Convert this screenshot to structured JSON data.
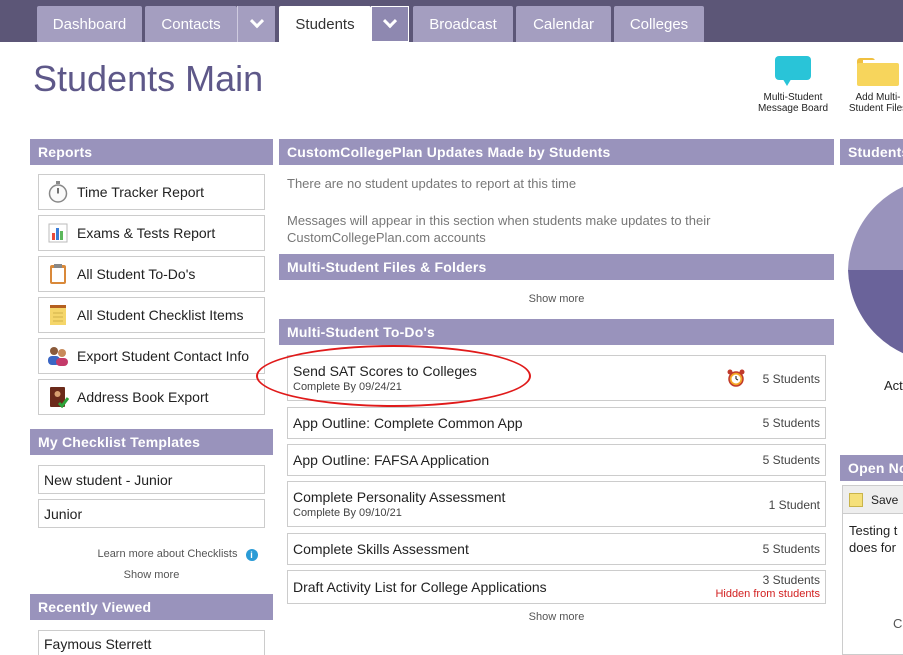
{
  "nav": {
    "tabs": [
      {
        "label": "Dashboard"
      },
      {
        "label": "Contacts"
      },
      {
        "label": "Students"
      },
      {
        "label": "Broadcast"
      },
      {
        "label": "Calendar"
      },
      {
        "label": "Colleges"
      }
    ]
  },
  "page": {
    "title": "Students Main"
  },
  "top_icons": [
    {
      "label": "Multi-Student Message Board",
      "icon": "speech-bubble-icon",
      "color": "#29c4d8"
    },
    {
      "label": "Add Multi-Student Files",
      "icon": "folder-icon",
      "color": "#f7d55c"
    }
  ],
  "reports": {
    "title": "Reports",
    "items": [
      {
        "label": "Time Tracker Report",
        "icon": "stopwatch-icon"
      },
      {
        "label": "Exams & Tests Report",
        "icon": "bar-chart-icon"
      },
      {
        "label": "All Student To-Do's",
        "icon": "clipboard-icon"
      },
      {
        "label": "All Student Checklist Items",
        "icon": "notepad-icon"
      },
      {
        "label": "Export Student Contact Info",
        "icon": "people-icon"
      },
      {
        "label": "Address Book Export",
        "icon": "address-book-icon"
      }
    ]
  },
  "checklists": {
    "title": "My Checklist Templates",
    "items": [
      {
        "label": "New student - Junior"
      },
      {
        "label": "Junior"
      }
    ],
    "learn_more": "Learn more about Checklists",
    "show_more": "Show more"
  },
  "recent": {
    "title": "Recently Viewed",
    "items": [
      {
        "label": "Faymous Sterrett"
      }
    ]
  },
  "updates": {
    "title": "CustomCollegePlan Updates Made by Students",
    "empty": "There are no student updates to report at this time",
    "note": "Messages will appear in this section when students make updates to their CustomCollegePlan.com accounts"
  },
  "files": {
    "title": "Multi-Student Files & Folders",
    "show_more": "Show more"
  },
  "todos": {
    "title": "Multi-Student To-Do's",
    "items": [
      {
        "title": "Send SAT Scores to Colleges",
        "sub": "Complete By 09/24/21",
        "count": "5 Students",
        "alarm": true
      },
      {
        "title": "App Outline: Complete Common App",
        "count": "5 Students"
      },
      {
        "title": "App Outline: FAFSA Application",
        "count": "5 Students"
      },
      {
        "title": "Complete Personality Assessment",
        "sub": "Complete By 09/10/21",
        "count": "1 Student"
      },
      {
        "title": "Complete Skills Assessment",
        "count": "5 Students"
      },
      {
        "title": "Draft Activity List for College Applications",
        "count": "3 Students",
        "hidden": "Hidden from students"
      }
    ],
    "show_more": "Show more"
  },
  "right": {
    "students_title": "Students",
    "pie_label": "Act",
    "open_notes_title": "Open No",
    "save_label": "Save",
    "note_text_1": "Testing t",
    "note_text_2": "does for",
    "bottom_text": "C"
  },
  "colors": {
    "nav_bg": "#5c5677",
    "tab_bg": "#a49ec0",
    "header_bg": "#9993bc",
    "title_color": "#5e5889",
    "highlight_oval": "#e01a1a",
    "hidden_red": "#d21f1f"
  }
}
